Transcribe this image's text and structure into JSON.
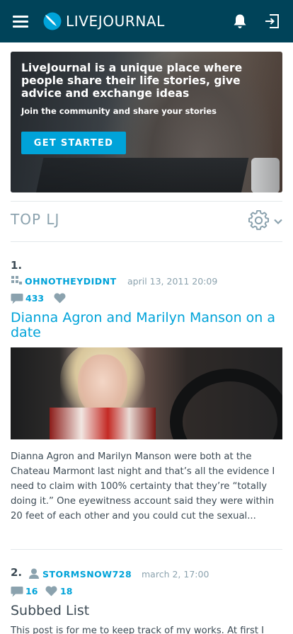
{
  "header": {
    "logo_text": "LIVEJOURNAL",
    "icons": [
      "menu-icon",
      "livejournal-logo-icon",
      "bell-icon",
      "login-icon"
    ],
    "background": "#004359"
  },
  "hero": {
    "title": "LiveJournal is a unique place where people share their life stories, give advice and exchange ideas",
    "subtitle": "Join the community and share your stories",
    "button_label": "GET STARTED",
    "button_color": "#00a3d9"
  },
  "top": {
    "title": "TOP LJ",
    "icons": [
      "gear-icon",
      "chevron-down-icon"
    ]
  },
  "posts": [
    {
      "number": "1.",
      "author": "OHNOTHEYDIDNT",
      "author_type": "community-icon",
      "date": "april 13, 2011 20:09",
      "comments": "433",
      "likes": "",
      "title": "Dianna Agron and Marilyn Manson on a date",
      "excerpt": "Dianna Agron and Marilyn Manson were both at the Chateau Marmont last night and that’s all the evidence I need to claim with 100% certainty that they’re “totally doing it.” One eyewitness account said they were within 20 feet of each other and you could cut the sexual..."
    },
    {
      "number": "2.",
      "author": "STORMSNOW728",
      "author_type": "user-icon",
      "date": "march 2, 17:00",
      "comments": "16",
      "likes": "18",
      "title": "Subbed List",
      "excerpt": "This post is for me to keep track of my works. At first I"
    }
  ],
  "colors": {
    "accent": "#00a3d9",
    "text": "#3c4a54",
    "muted": "#8ba2ae"
  }
}
